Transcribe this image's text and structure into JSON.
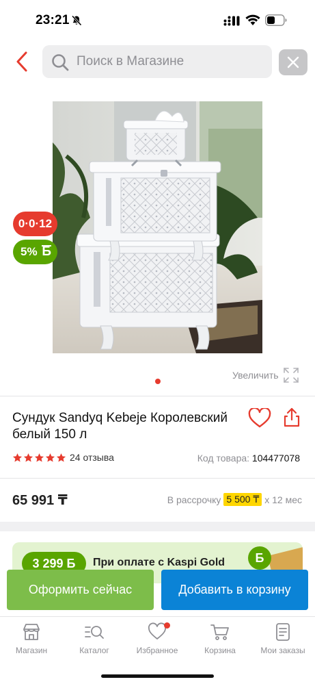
{
  "status_bar": {
    "time": "23:21",
    "bell_icon": "bell-slash-icon",
    "signal_icon": "cellular-signal-icon",
    "wifi_icon": "wifi-icon",
    "battery_icon": "battery-icon"
  },
  "header": {
    "back_icon": "chevron-left-icon",
    "search_placeholder": "Поиск в Магазине",
    "search_value": "",
    "clear_icon": "close-icon"
  },
  "product": {
    "timer_badge": "0·0·12",
    "bonus_badge_percent": "5%",
    "bonus_badge_symbol": "Б",
    "zoom_label": "Увеличить",
    "title": "Сундук Sandyq Kebeje Королевский белый 150 л",
    "rating_stars": 5,
    "reviews": "24 отзыва",
    "code_label": "Код товара:",
    "code_value": "104477078",
    "price": "65 991 ₸",
    "installment_label": "В рассрочку",
    "installment_amount": "5 500 ₸",
    "installment_term": "х 12 мес"
  },
  "promo": {
    "amount": "3 299 Б",
    "text": "При оплате с Kaspi Gold",
    "coin_symbol": "Б"
  },
  "actions": {
    "buy_now": "Оформить сейчас",
    "add_to_cart": "Добавить в корзину"
  },
  "tabbar": {
    "items": [
      {
        "label": "Магазин",
        "icon": "store-icon"
      },
      {
        "label": "Каталог",
        "icon": "catalog-search-icon"
      },
      {
        "label": "Избранное",
        "icon": "heart-icon"
      },
      {
        "label": "Корзина",
        "icon": "cart-icon"
      },
      {
        "label": "Мои заказы",
        "icon": "orders-icon"
      }
    ]
  },
  "colors": {
    "accent_red": "#e63b2e",
    "bonus_green": "#59a500",
    "buy_green": "#7dbd4a",
    "cart_blue": "#0b83d6",
    "installment_yellow": "#ffd600"
  }
}
